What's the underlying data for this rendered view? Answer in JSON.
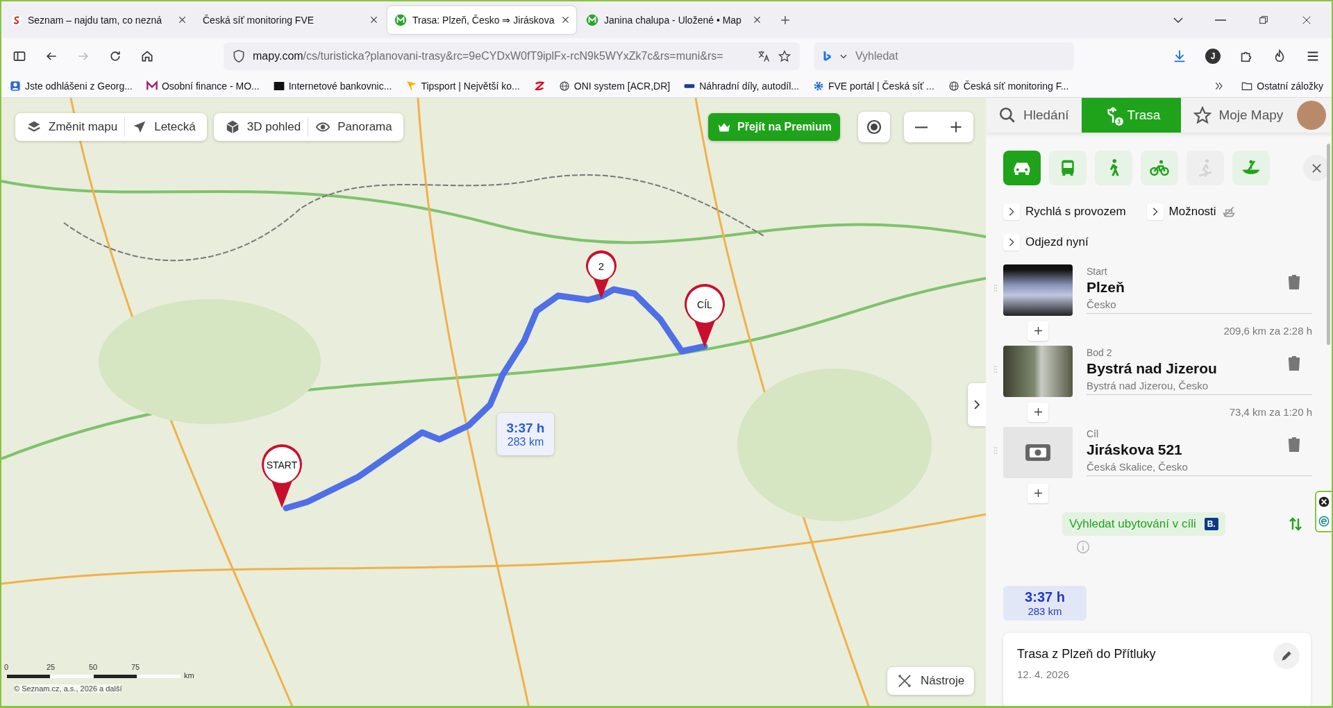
{
  "browser": {
    "tabs": [
      {
        "title": "Seznam – najdu tam, co nezná",
        "selected": false
      },
      {
        "title": "Česká síť monitoring FVE",
        "selected": false
      },
      {
        "title": "Trasa: Plzeň, Česko ⇒ Jiráskova",
        "selected": true
      },
      {
        "title": "Janina chalupa - Uložené • Map",
        "selected": false
      }
    ],
    "nav": [
      {
        "kind": "sidebar",
        "disabled": false
      },
      {
        "kind": "back",
        "disabled": false
      },
      {
        "kind": "forward",
        "disabled": true
      },
      {
        "kind": "reload",
        "disabled": false
      },
      {
        "kind": "home",
        "disabled": false
      }
    ],
    "url_host": "mapy.com",
    "url_path": "/cs/turisticka?planovani-trasy&rc=9eCYDxW0fT9iplFx-rcN9k5WYxZk7c&rs=muni&rs=",
    "search": {
      "placeholder": "Vyhledat"
    },
    "account": "J",
    "bookmarks": [
      {
        "label": "Jste odhlášeni z Georg..."
      },
      {
        "label": "Osobní finance - MO..."
      },
      {
        "label": "Internetové bankovnic..."
      },
      {
        "label": "Tipsport | Největší ko..."
      },
      {
        "label": "ONI system [ACR,DR]"
      },
      {
        "label": "Náhradní díly, autodíl..."
      },
      {
        "label": "FVE portál | Česká síť ..."
      },
      {
        "label": "Česká síť monitoring F..."
      }
    ],
    "other_bookmarks": "Ostatní záložky"
  },
  "map": {
    "layer_controls": [
      {
        "label": "Změnit mapu"
      },
      {
        "label": "Letecká"
      }
    ],
    "view_controls": [
      {
        "label": "3D pohled"
      },
      {
        "label": "Panorama"
      }
    ],
    "premium": "Přejít na Premium",
    "markers": [
      {
        "label": "START"
      },
      {
        "label": "2"
      },
      {
        "label": "CÍL"
      }
    ],
    "route_badge": {
      "time": "3:37 h",
      "distance": "283 km"
    },
    "tools": "Nástroje",
    "scale": {
      "ticks": [
        "0",
        "25",
        "50",
        "75"
      ],
      "unit": "km"
    },
    "copyright": "© Seznam.cz, a.s., 2026 a další"
  },
  "panel": {
    "tabs": [
      {
        "label": "Hledání",
        "selected": false
      },
      {
        "label": "Trasa",
        "badge": "3",
        "selected": true
      },
      {
        "label": "Moje Mapy",
        "selected": false
      }
    ],
    "modes": [
      {
        "kind": "car",
        "selected": true,
        "disabled": false
      },
      {
        "kind": "bus",
        "selected": false,
        "disabled": false
      },
      {
        "kind": "walk",
        "selected": false,
        "disabled": false
      },
      {
        "kind": "bike",
        "selected": false,
        "disabled": false
      },
      {
        "kind": "ski",
        "selected": false,
        "disabled": true
      },
      {
        "kind": "canoe",
        "selected": false,
        "disabled": false
      }
    ],
    "options": [
      {
        "label": "Rychlá s provozem",
        "kind": "plain"
      },
      {
        "label": "Možnosti",
        "kind": "ferry-off"
      },
      {
        "label": "Odjezd nyní",
        "kind": "plain"
      }
    ],
    "waypoints": [
      {
        "role": "Start",
        "name": "Plzeň",
        "place": "Česko",
        "segment": "209,6 km za 2:28 h"
      },
      {
        "role": "Bod 2",
        "name": "Bystrá nad Jizerou",
        "place": "Bystrá nad Jizerou, Česko",
        "segment": "73,4 km za 1:20 h"
      },
      {
        "role": "Cíl",
        "name": "Jiráskova 521",
        "place": "Česká Skalice, Česko"
      }
    ],
    "accommodation": {
      "label": "Vyhledat ubytování v cíli",
      "badge": "B."
    },
    "summary": {
      "time": "3:37 h",
      "distance": "283 km"
    },
    "saved_route": {
      "title": "Trasa z Plzeň do Přítluky",
      "date": "12. 4. 2026"
    }
  }
}
